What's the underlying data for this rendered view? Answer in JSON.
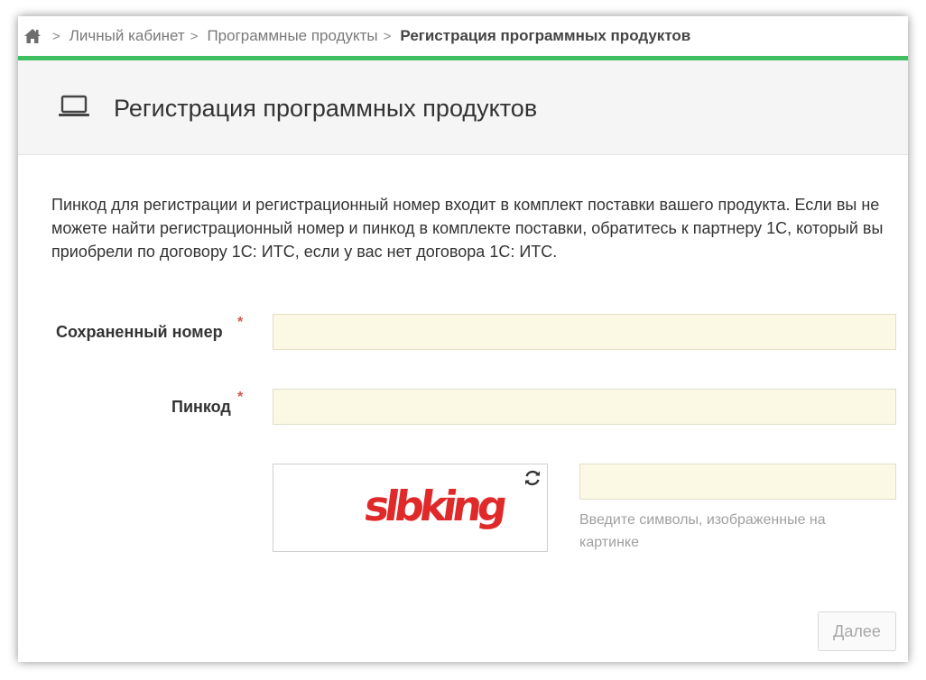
{
  "breadcrumb": {
    "items": [
      "Личный кабинет",
      "Программные продукты"
    ],
    "current": "Регистрация программных продуктов"
  },
  "header": {
    "title": "Регистрация программных продуктов",
    "icon": "laptop-icon"
  },
  "description": "Пинкод для регистрации и регистрационный номер входит в комплект поставки вашего продукта. Если вы не можете найти регистрационный номер и пинкод в комплекте поставки, обратитесь к партнеру 1С, который вы приобрели по договору 1С: ИТС, если у вас нет договора 1С: ИТС.",
  "form": {
    "saved_number_label": "Сохраненный номер",
    "saved_number_value": "",
    "pincode_label": "Пинкод",
    "pincode_value": "",
    "required_mark": "*",
    "captcha_text": "slbking",
    "captcha_value": "",
    "captcha_hint": "Введите символы, изображенные на картинке",
    "next_label": "Далее"
  },
  "colors": {
    "accent_line": "#3fbf5f",
    "input_background": "#fbf9e4",
    "required": "#d9534f",
    "captcha": "#e02a2a"
  }
}
